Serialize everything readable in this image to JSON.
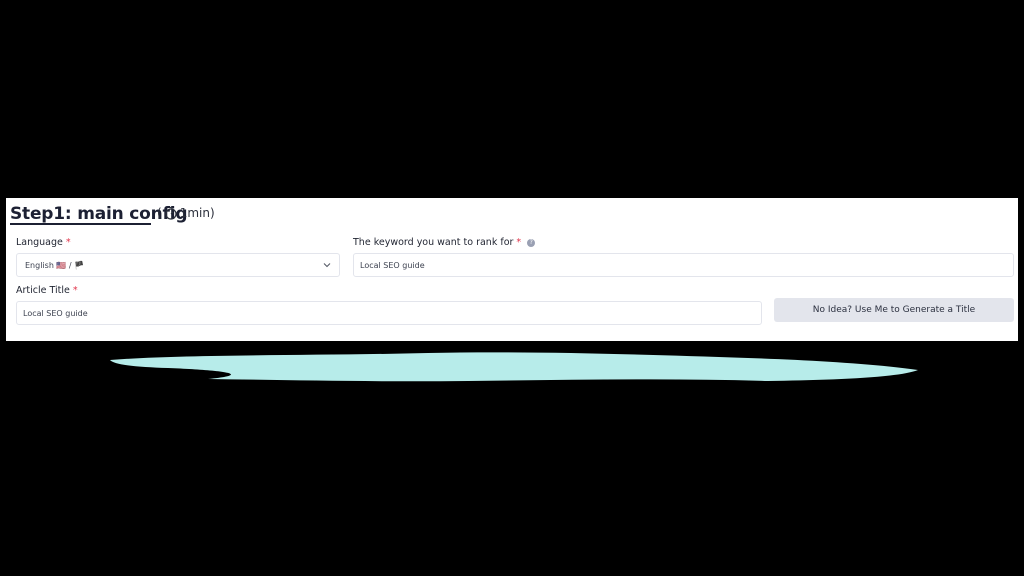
{
  "header": {
    "title": "Step1: main config",
    "duration_open": "(",
    "duration": "1min)"
  },
  "language": {
    "label": "Language",
    "required_mark": "*",
    "value": "English 🇺🇸 / 🏴"
  },
  "keyword": {
    "label": "The keyword you want to rank for",
    "required_mark": "*",
    "help_icon": "question-icon",
    "value": "Local SEO guide"
  },
  "article_title": {
    "label": "Article Title",
    "required_mark": "*",
    "value": "Local SEO guide"
  },
  "generate_button": {
    "label": "No Idea? Use Me to Generate a Title"
  },
  "colors": {
    "accent_underline": "#1c2033",
    "required": "#e0344a",
    "button_bg": "#e3e5ec",
    "brush": "#b7ecea"
  }
}
